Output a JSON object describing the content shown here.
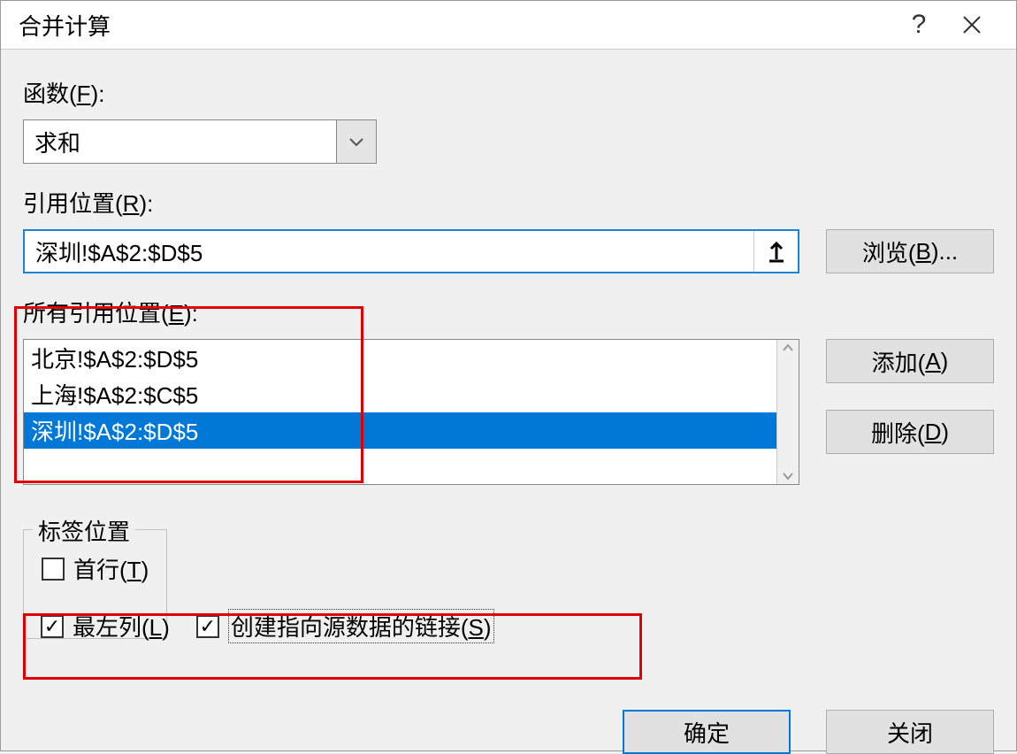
{
  "title": "合并计算",
  "titlebar": {
    "help": "?",
    "close": "×"
  },
  "function": {
    "label": "函数(F):",
    "value": "求和"
  },
  "reference": {
    "label": "引用位置(R):",
    "value": "深圳!$A$2:$D$5",
    "browse_label": "浏览(B)..."
  },
  "all_refs": {
    "label": "所有引用位置(E):",
    "items": [
      "北京!$A$2:$D$5",
      "上海!$A$2:$C$5",
      "深圳!$A$2:$D$5"
    ],
    "selected_index": 2,
    "add_label": "添加(A)",
    "delete_label": "删除(D)"
  },
  "labels_section": {
    "legend": "标签位置",
    "top_row": {
      "label": "首行(T)",
      "checked": false
    },
    "left_col": {
      "label": "最左列(L)",
      "checked": true
    },
    "create_links": {
      "label": "创建指向源数据的链接(S)",
      "checked": true
    }
  },
  "footer": {
    "ok": "确定",
    "close": "关闭"
  }
}
